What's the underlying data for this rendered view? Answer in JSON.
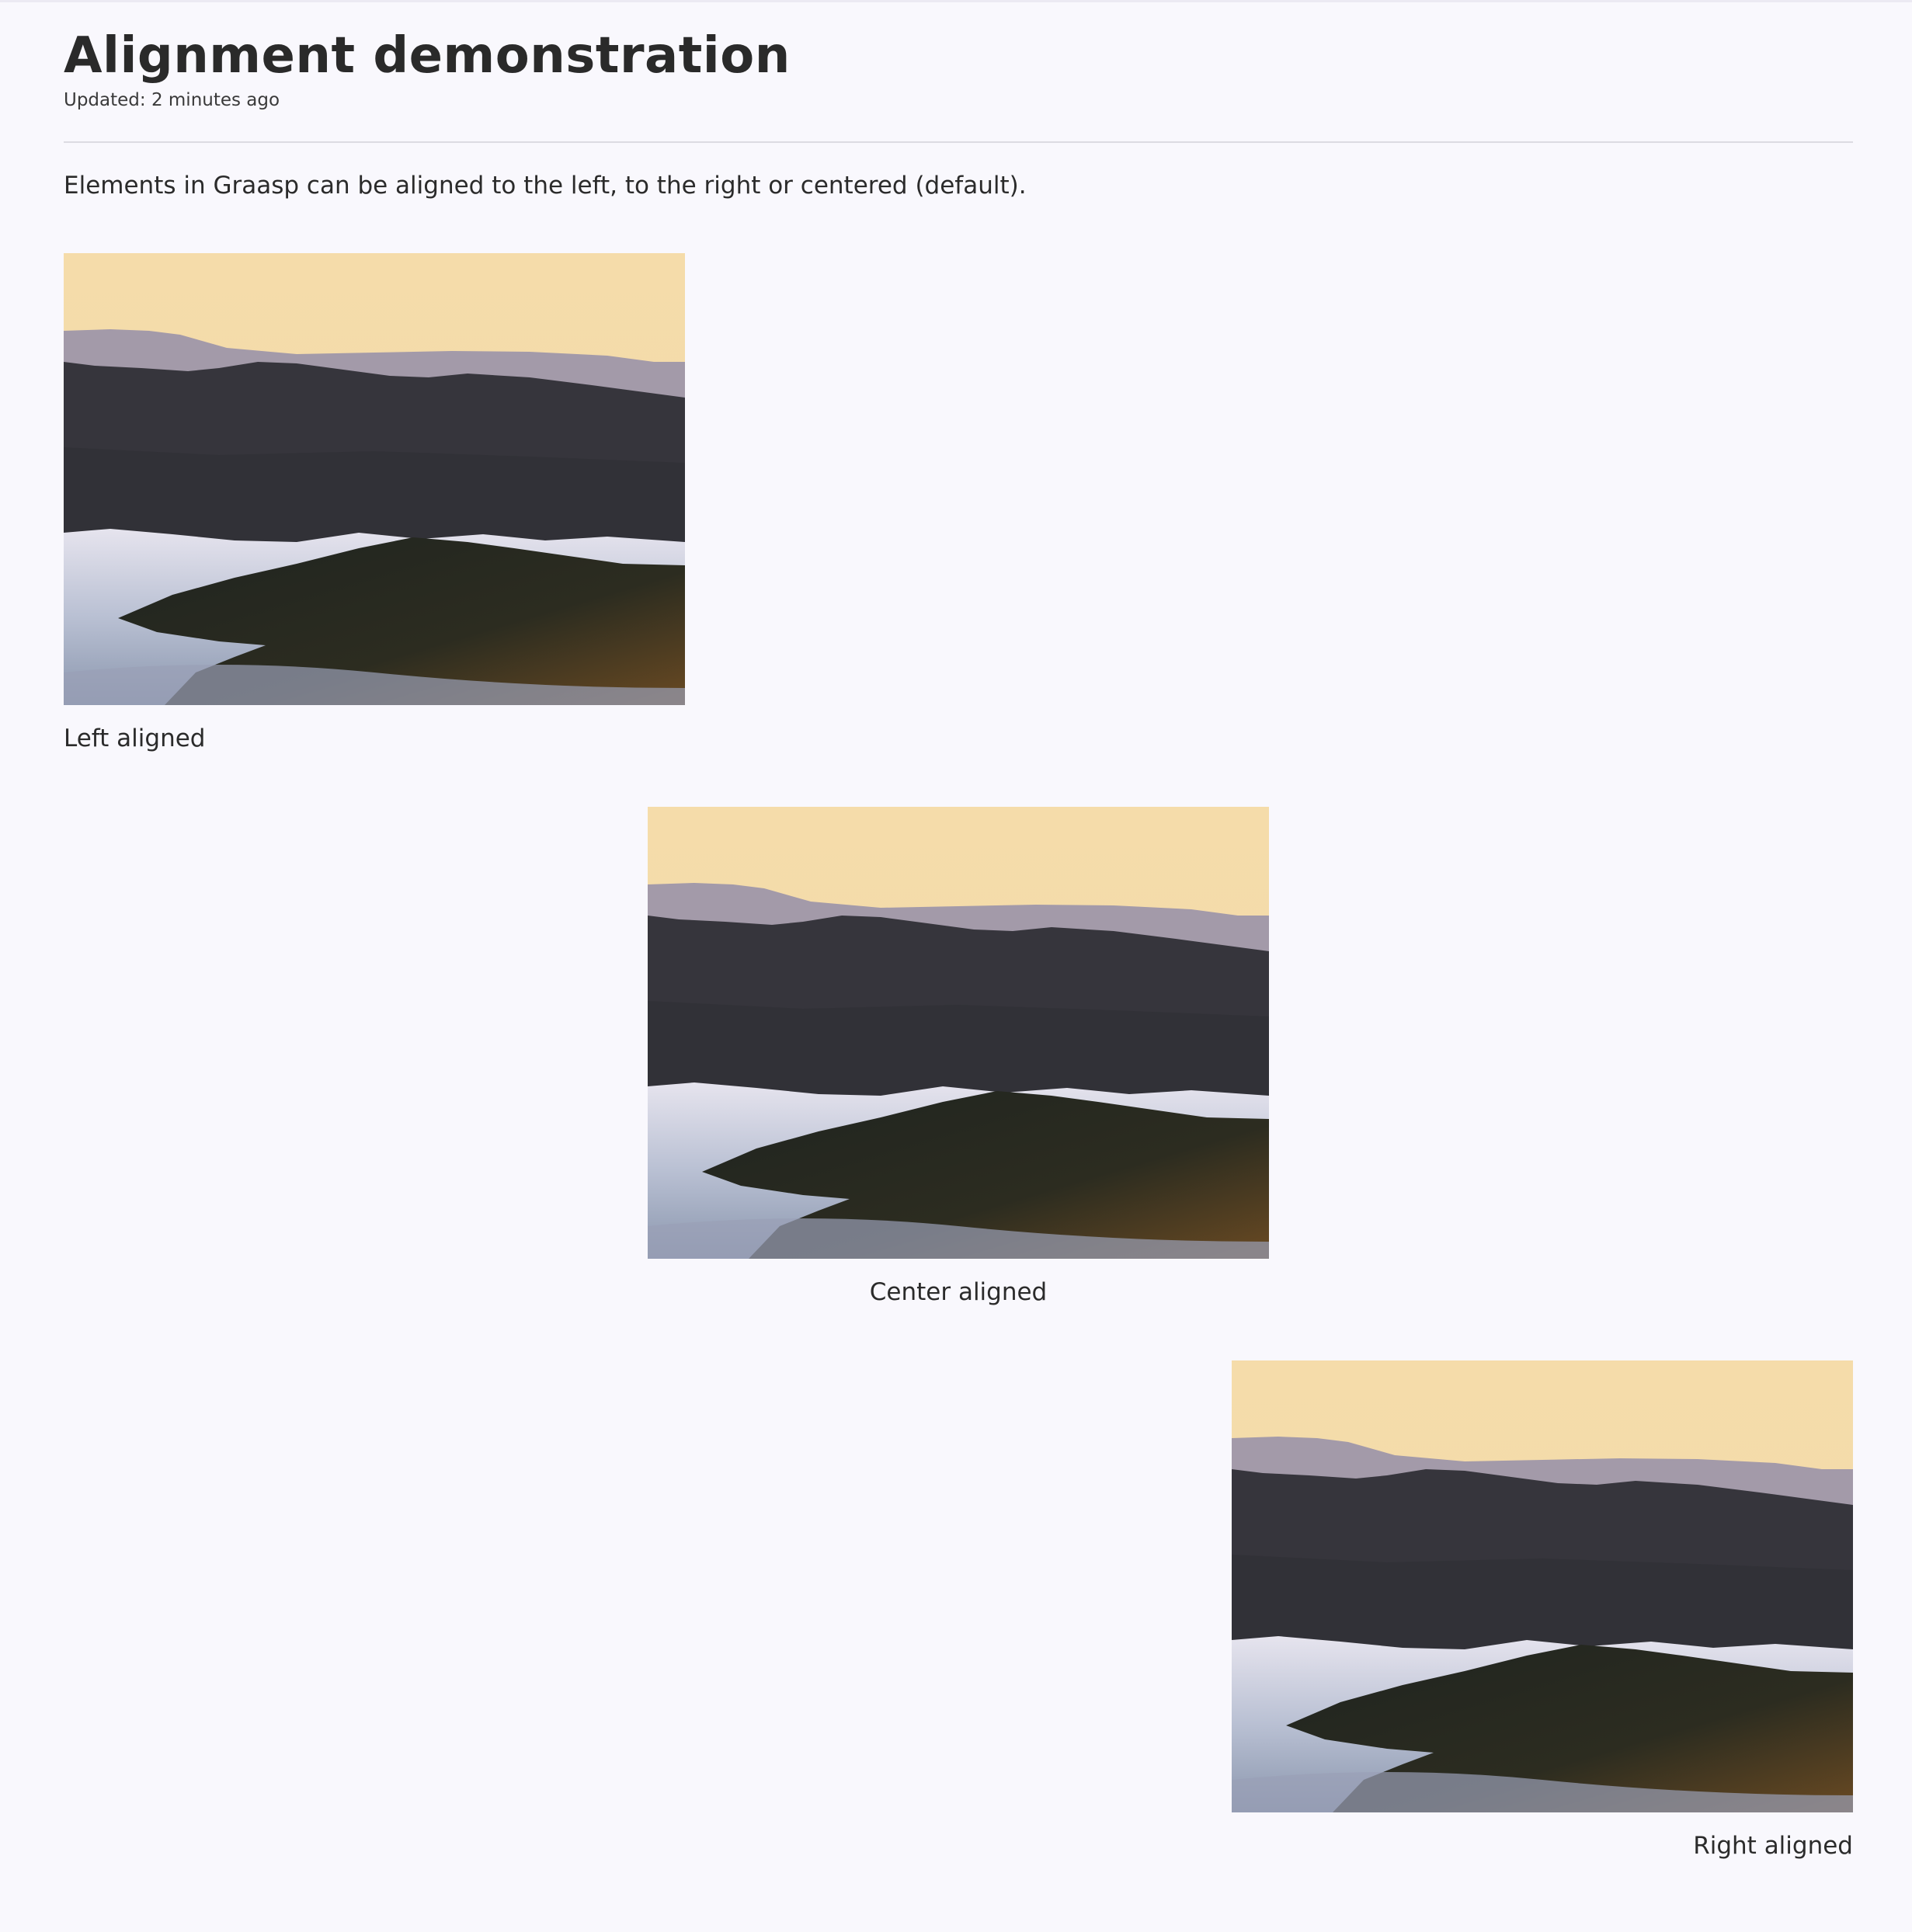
{
  "header": {
    "title": "Alignment demonstration",
    "updated": "Updated: 2 minutes ago"
  },
  "content": {
    "intro": "Elements in Graasp can be aligned to the left, to the right or centered (default).",
    "items": [
      {
        "alignment": "left",
        "caption": "Left aligned"
      },
      {
        "alignment": "center",
        "caption": "Center aligned"
      },
      {
        "alignment": "right",
        "caption": "Right aligned"
      }
    ]
  },
  "colors": {
    "background": "#f9f8fd",
    "text": "#2b2b2b",
    "divider": "#dcdbe2",
    "sky": "#f4dcaa",
    "mountain_far": "#a29aa8",
    "forest": "#33333a",
    "forest_near": "#2a2c22",
    "fog": "#c9cbdb"
  }
}
